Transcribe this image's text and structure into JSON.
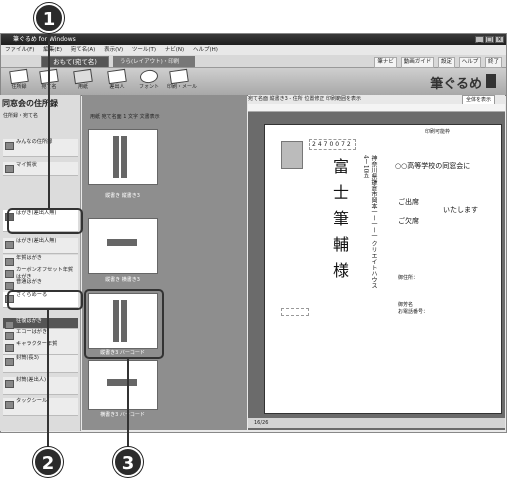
{
  "window": {
    "title": "筆ぐるめ for Windows",
    "menu": [
      "ファイル(F)",
      "編集(E)",
      "宛て名(A)",
      "表示(V)",
      "ツール(T)",
      "ナビ(N)",
      "ヘルプ(H)"
    ]
  },
  "tabs": {
    "active": "おもて(宛て名)",
    "inactive": "うら(レイアウト)・印刷"
  },
  "topnav": [
    "筆ナビ",
    "動画ガイド",
    "設定",
    "ヘルプ",
    "終了"
  ],
  "toolbar": [
    "住所録",
    "宛て名",
    "用紙",
    "差出人",
    "フォント",
    "印刷・メール"
  ],
  "brand": "筆ぐるめ",
  "left": {
    "title": "同窓会の住所録",
    "rows": [
      "住所録・宛て名",
      "みんなの住所録",
      "マイ賀状",
      "はがき(差出人無)",
      "はがき(差出人無)",
      "年賀はがき",
      "カーボンオフセット年賀はがき",
      "普通はがき",
      "さくらめーる",
      "往復はがき",
      "エコーはがき",
      "キャラクター年賀",
      "封筒(長3)",
      "封筒(差出人)",
      "タックシール"
    ]
  },
  "thumbs": {
    "header": [
      "用紙",
      "宛て名面",
      "1 文字",
      "文書表示"
    ],
    "captions": [
      "縦書き 縦書き3",
      "縦書き 横書き3",
      "縦書き3 バーコード",
      "横書き3 バーコード"
    ]
  },
  "preview": {
    "header": [
      "宛て名面",
      "縦書き3 - 住所",
      "位置修正",
      "印刷範囲を表示"
    ],
    "zoom": "全体を表示",
    "postal_code": "2470072",
    "stamp_label": "印刷可能枠",
    "address": "神奈川県鎌倉市岡本一ー一ー一 クリエイトハウス4ー10五",
    "name_big": "富士筆輔様",
    "right_lines": [
      "○○高等学校の同窓会に",
      "ご出席",
      "いたします",
      "ご欠席",
      "御住所：",
      "御芳名",
      "お電話番号："
    ],
    "page": "16/26"
  },
  "callouts": [
    "1",
    "2",
    "3"
  ]
}
